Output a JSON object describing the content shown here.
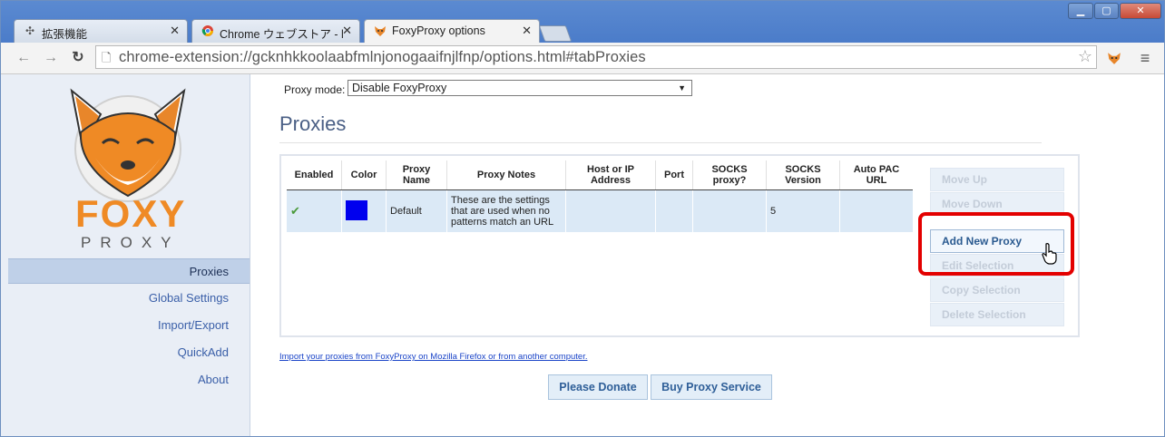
{
  "browser": {
    "tabs": [
      {
        "title": "拡張機能",
        "icon": "puzzle-icon",
        "active": false
      },
      {
        "title": "Chrome ウェブストア - l",
        "icon": "chrome-webstore-icon",
        "active": false
      },
      {
        "title": "FoxyProxy options",
        "icon": "fox-icon",
        "active": true
      }
    ],
    "url": "chrome-extension://gcknhkkoolaabfmlnjonogaaifnjlfnp/options.html#tabProxies",
    "window_controls": [
      "minimize",
      "maximize",
      "close"
    ]
  },
  "sidebar": {
    "logo_text_top": "FOXY",
    "logo_text_bottom": "PROXY",
    "items": [
      {
        "label": "Proxies",
        "active": true
      },
      {
        "label": "Global Settings",
        "active": false
      },
      {
        "label": "Import/Export",
        "active": false
      },
      {
        "label": "QuickAdd",
        "active": false
      },
      {
        "label": "About",
        "active": false
      }
    ]
  },
  "main": {
    "proxy_mode_label": "Proxy mode:",
    "proxy_mode_value": "Disable FoxyProxy",
    "title": "Proxies",
    "table": {
      "headers": [
        "Enabled",
        "Color",
        "Proxy Name",
        "Proxy Notes",
        "Host or IP Address",
        "Port",
        "SOCKS proxy?",
        "SOCKS Version",
        "Auto PAC URL"
      ],
      "rows": [
        {
          "enabled": "✔",
          "color": "#0000ee",
          "name": "Default",
          "notes": "These are the settings that are used when no patterns match an URL",
          "host": "",
          "port": "",
          "socks": "",
          "socks_version": "5",
          "pac": ""
        }
      ]
    },
    "side_buttons": [
      {
        "label": "Move Up",
        "enabled": false
      },
      {
        "label": "Move Down",
        "enabled": false
      },
      {
        "label": "Add New Proxy",
        "enabled": true
      },
      {
        "label": "Edit Selection",
        "enabled": false
      },
      {
        "label": "Copy Selection",
        "enabled": false
      },
      {
        "label": "Delete Selection",
        "enabled": false
      }
    ],
    "import_link": "Import your proxies from FoxyProxy on Mozilla Firefox or from another computer.",
    "donate_label": "Please Donate",
    "buy_label": "Buy Proxy Service"
  }
}
